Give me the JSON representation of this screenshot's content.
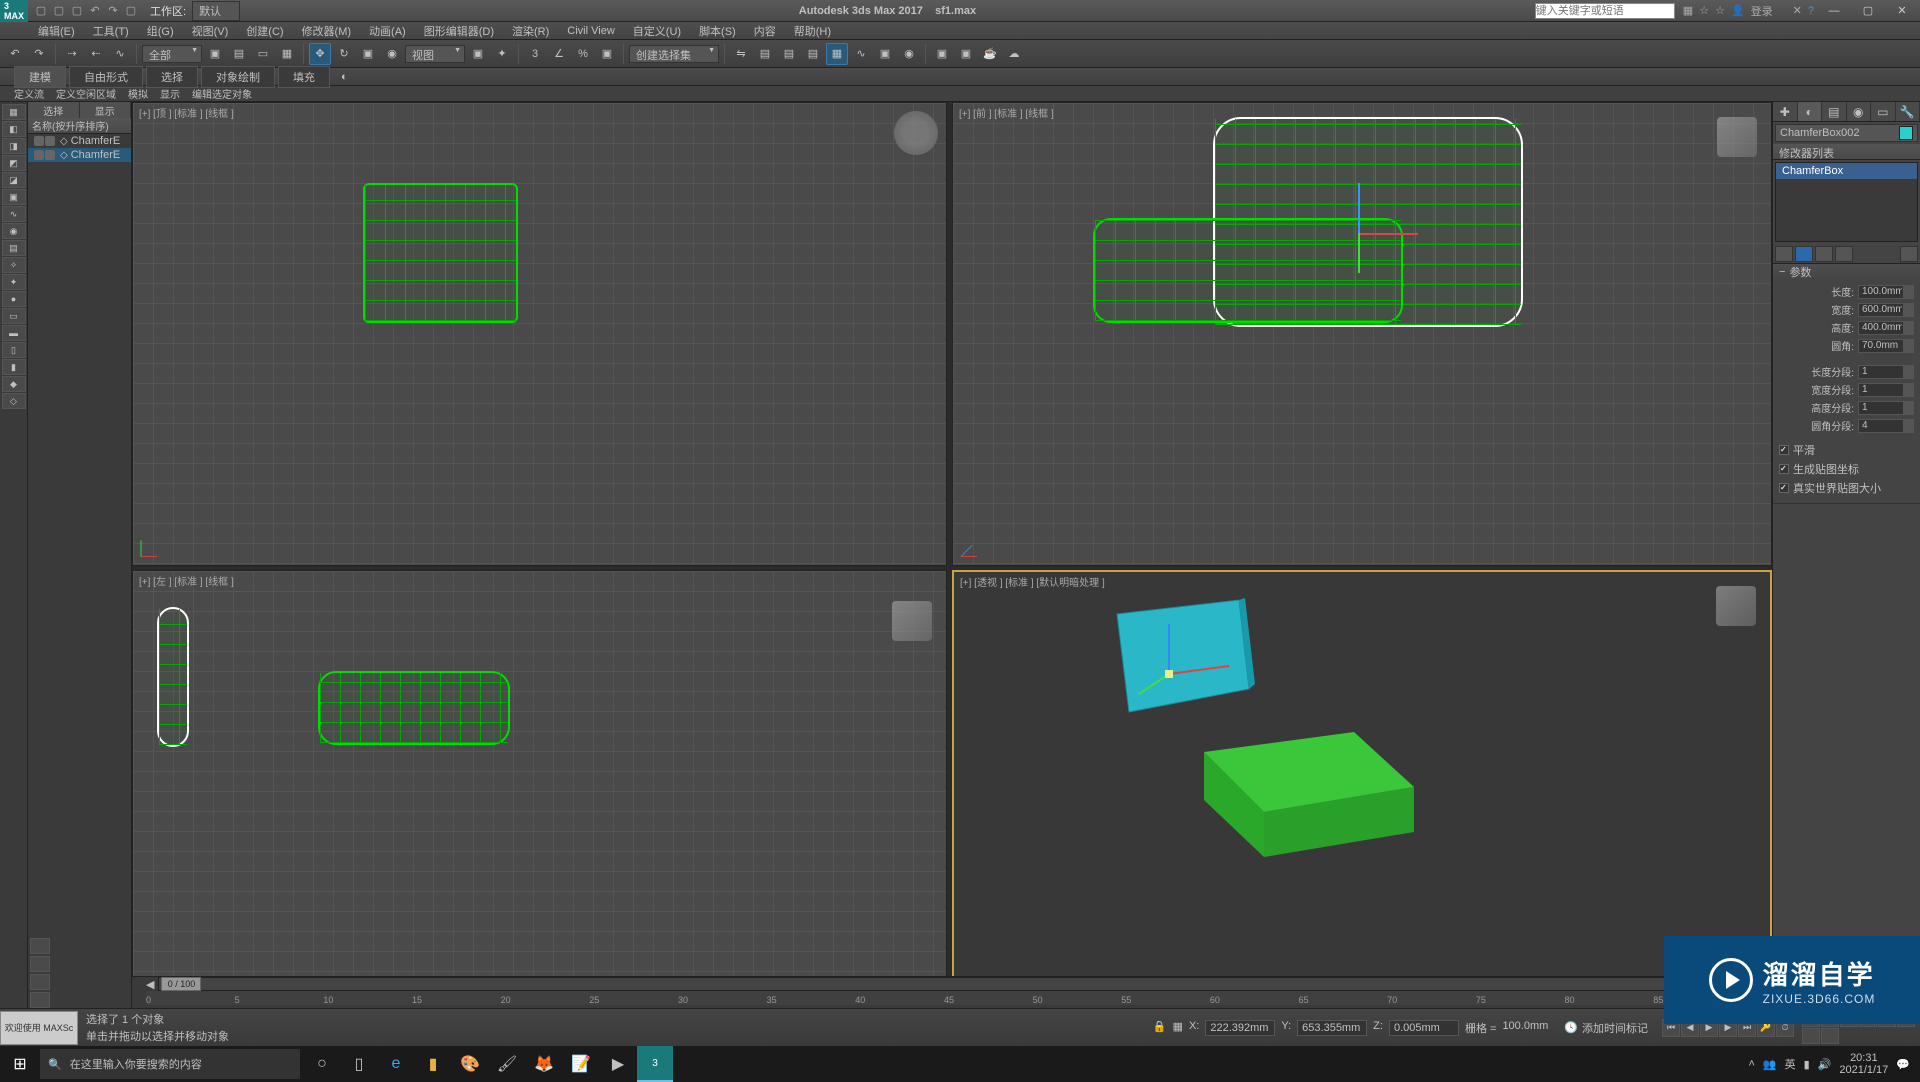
{
  "title": {
    "app": "Autodesk 3ds Max 2017",
    "file": "sf1.max",
    "workspace_label": "工作区:",
    "workspace_value": "默认",
    "login": "登录",
    "search_placeholder": "键入关键字或短语"
  },
  "menus": [
    "编辑(E)",
    "工具(T)",
    "组(G)",
    "视图(V)",
    "创建(C)",
    "修改器(M)",
    "动画(A)",
    "图形编辑器(D)",
    "渲染(R)",
    "Civil View",
    "自定义(U)",
    "脚本(S)",
    "内容",
    "帮助(H)"
  ],
  "main_toolbar": {
    "filter": "全部",
    "ref_coord": "视图",
    "selset": "创建选择集"
  },
  "ribbon": {
    "tabs": [
      "建模",
      "自由形式",
      "选择",
      "对象绘制",
      "填充"
    ],
    "sub": [
      "定义流",
      "定义空闲区域",
      "模拟",
      "显示",
      "编辑选定对象"
    ]
  },
  "scene_explorer": {
    "tabs": [
      "选择",
      "显示"
    ],
    "header": "名称(按升序排序)",
    "items": [
      "ChamferE",
      "ChamferE"
    ]
  },
  "viewports": {
    "top": "[+] [顶 ] [标准 ] [线框 ]",
    "front": "[+] [前 ] [标准 ] [线框 ]",
    "left": "[+] [左 ] [标准 ] [线框 ]",
    "persp": "[+] [透视 ] [标准 ] [默认明暗处理 ]"
  },
  "cmd_panel": {
    "object_name": "ChamferBox002",
    "modlist_header": "修改器列表",
    "stack_item": "ChamferBox",
    "rollout": "参数",
    "params": {
      "length_lbl": "长度:",
      "length": "100.0mm",
      "width_lbl": "宽度:",
      "width": "600.0mm",
      "height_lbl": "高度:",
      "height": "400.0mm",
      "fillet_lbl": "圆角:",
      "fillet": "70.0mm",
      "lseg_lbl": "长度分段:",
      "lseg": "1",
      "wseg_lbl": "宽度分段:",
      "wseg": "1",
      "hseg_lbl": "高度分段:",
      "hseg": "1",
      "fseg_lbl": "圆角分段:",
      "fseg": "4",
      "smooth": "平滑",
      "genmap": "生成贴图坐标",
      "realws": "真实世界贴图大小"
    }
  },
  "timeslider": {
    "label": "0 / 100",
    "ticks": [
      0,
      5,
      10,
      15,
      20,
      25,
      30,
      35,
      40,
      45,
      50,
      55,
      60,
      65,
      70,
      75,
      80,
      85
    ]
  },
  "status": {
    "welcome": "欢迎使用  MAXSc",
    "sel": "选择了 1 个对象",
    "prompt": "单击并拖动以选择并移动对象",
    "x_lbl": "X:",
    "x": "222.392mm",
    "y_lbl": "Y:",
    "y": "653.355mm",
    "z_lbl": "Z:",
    "z": "0.005mm",
    "grid_lbl": "栅格 =",
    "grid": "100.0mm",
    "addtag": "添加时间标记"
  },
  "watermark": {
    "cn": "溜溜自学",
    "url": "ZIXUE.3D66.COM"
  },
  "taskbar": {
    "search": "在这里输入你要搜索的内容",
    "time": "20:31",
    "date": "2021/1/17"
  }
}
